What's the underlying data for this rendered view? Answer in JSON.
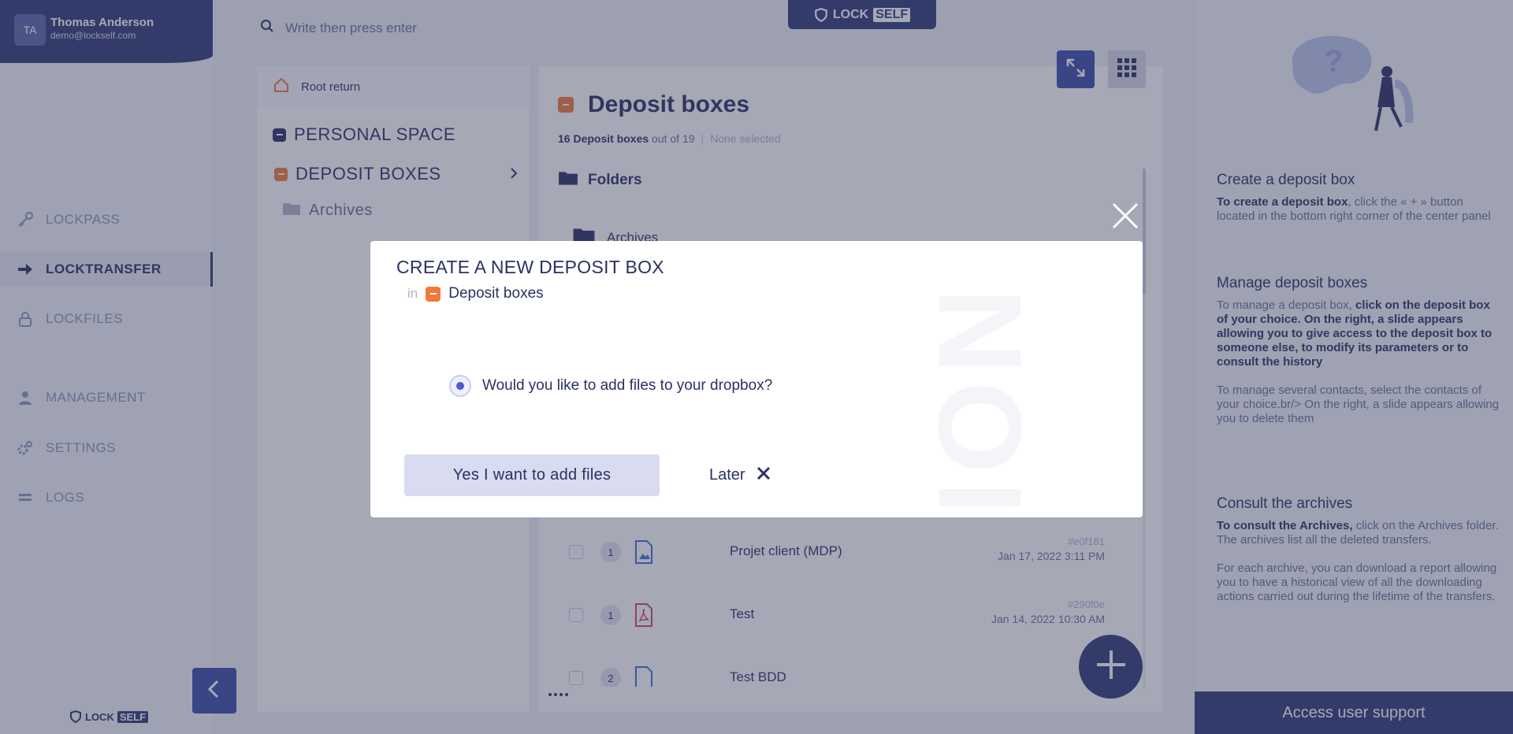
{
  "user": {
    "initials": "TA",
    "name": "Thomas Anderson",
    "email": "demo@lockself.com"
  },
  "brand": {
    "lock": "LOCK",
    "self": "SELF"
  },
  "nav": [
    {
      "label": "LOCKPASS",
      "icon": "key-icon"
    },
    {
      "label": "LOCKTRANSFER",
      "icon": "arrow-right-icon"
    },
    {
      "label": "LOCKFILES",
      "icon": "padlock-icon"
    },
    {
      "label": "MANAGEMENT",
      "icon": "user-icon"
    },
    {
      "label": "SETTINGS",
      "icon": "gears-icon"
    },
    {
      "label": "LOGS",
      "icon": "logs-icon"
    }
  ],
  "search": {
    "placeholder": "Write then press enter"
  },
  "tree": {
    "root_return": "Root return",
    "personal_space": "PERSONAL SPACE",
    "deposit_boxes": "DEPOSIT BOXES",
    "archives": "Archives"
  },
  "center": {
    "title": "Deposit boxes",
    "count_bold": "16 Deposit boxes",
    "count_rest": "out of 19",
    "selection": "None selected",
    "folders_heading": "Folders",
    "archives_folder": "Archives",
    "rows": [
      {
        "count": "1",
        "name": "Projet client (MDP)",
        "ref": "#e0f181",
        "date": "Jan 17, 2022 3:11 PM"
      },
      {
        "count": "1",
        "name": "Test",
        "ref": "#290f0e",
        "date": "Jan 14, 2022 10:30 AM"
      },
      {
        "count": "2",
        "name": "Test BDD",
        "ref": "#",
        "date": ""
      }
    ]
  },
  "help": {
    "sections": [
      {
        "title": "Create a deposit box",
        "paras": [
          {
            "bold": "To create a deposit box",
            "text": ", click the « + » button located in the bottom right corner of the center panel"
          }
        ]
      },
      {
        "title": "Manage deposit boxes",
        "paras": [
          {
            "lead": "To manage a deposit box, ",
            "bold": "click on the deposit box of your choice. On the right, a slide appears allowing you to give access to the deposit box to someone else, to modify its parameters or to consult the history",
            "text": ""
          },
          {
            "lead": "To manage several contacts, select the contacts of your choice.br/> On the right, a slide appears allowing you to delete them",
            "bold": "",
            "text": ""
          }
        ]
      },
      {
        "title": "Consult the archives",
        "paras": [
          {
            "bold": "To consult the Archives,",
            "text": " click on the Archives folder. The archives list all the deleted transfers."
          },
          {
            "lead": "For each archive, you can download a report allowing you to have a historical view of all the downloading actions carried out during the lifetime of the transfers.",
            "bold": "",
            "text": ""
          }
        ]
      }
    ],
    "support": "Access user support"
  },
  "modal": {
    "title": "CREATE A NEW DEPOSIT BOX",
    "in_label": "in",
    "destination": "Deposit boxes",
    "watermark": "NOIT",
    "question": "Would you like to add files to your dropbox?",
    "yes_label": "Yes I want to add files",
    "later_label": "Later"
  },
  "colors": {
    "primary": "#2f3a77",
    "accent_orange": "#f07a3b",
    "text": "#2b3163",
    "muted": "#8f95b9"
  }
}
